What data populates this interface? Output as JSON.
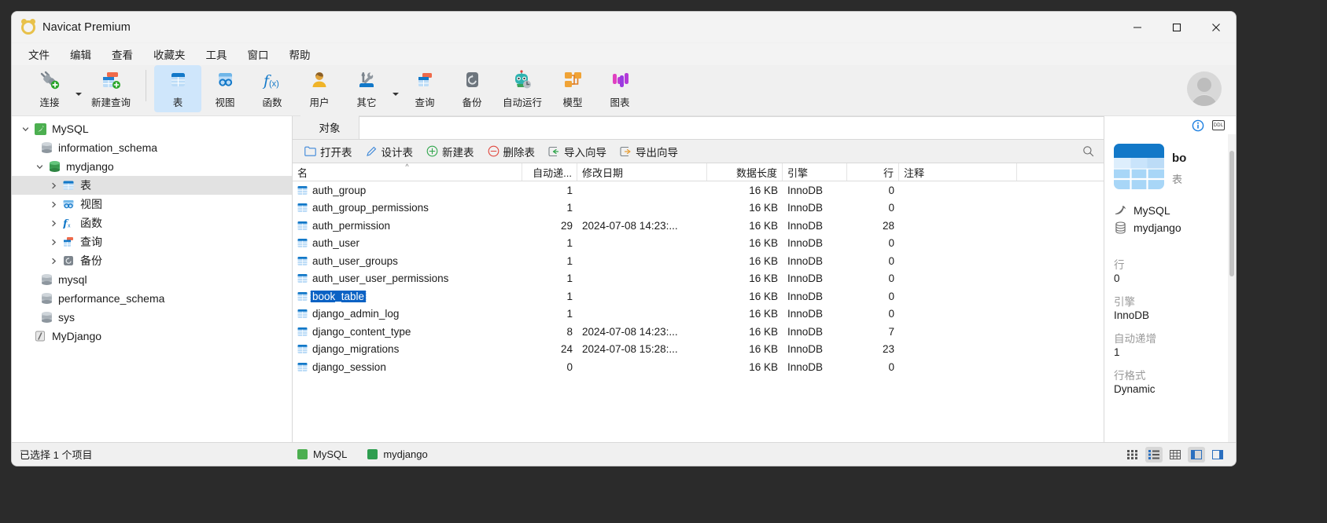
{
  "window": {
    "title": "Navicat Premium",
    "app_icon": "navicat-logo-icon",
    "minimize": "minimize-icon",
    "maximize": "maximize-icon",
    "close": "close-icon"
  },
  "menubar": {
    "items": [
      {
        "label": "文件"
      },
      {
        "label": "编辑"
      },
      {
        "label": "查看"
      },
      {
        "label": "收藏夹"
      },
      {
        "label": "工具"
      },
      {
        "label": "窗口"
      },
      {
        "label": "帮助"
      }
    ]
  },
  "toolbar": {
    "items": [
      {
        "label": "连接",
        "icon": "connection-icon",
        "caret": true,
        "active": false
      },
      {
        "label": "新建查询",
        "icon": "new-query-icon",
        "caret": false,
        "active": false
      },
      {
        "label": "表",
        "icon": "table-icon",
        "caret": false,
        "active": true
      },
      {
        "label": "视图",
        "icon": "view-icon",
        "caret": false,
        "active": false
      },
      {
        "label": "函数",
        "icon": "function-icon",
        "caret": false,
        "active": false
      },
      {
        "label": "用户",
        "icon": "user-icon",
        "caret": false,
        "active": false
      },
      {
        "label": "其它",
        "icon": "other-tools-icon",
        "caret": true,
        "active": false
      },
      {
        "label": "查询",
        "icon": "query-icon",
        "caret": false,
        "active": false
      },
      {
        "label": "备份",
        "icon": "backup-icon",
        "caret": false,
        "active": false
      },
      {
        "label": "自动运行",
        "icon": "automation-icon",
        "caret": false,
        "active": false
      },
      {
        "label": "模型",
        "icon": "model-icon",
        "caret": false,
        "active": false
      },
      {
        "label": "图表",
        "icon": "chart-icon",
        "caret": false,
        "active": false
      }
    ],
    "avatar": "user-avatar"
  },
  "sidebar": {
    "items": [
      {
        "label": "MySQL",
        "indent": 0,
        "twisty": "expanded",
        "icon": "mysql-connection-icon",
        "selected": false
      },
      {
        "label": "information_schema",
        "indent": 1,
        "twisty": "none",
        "icon": "database-icon",
        "selected": false
      },
      {
        "label": "mydjango",
        "indent": 1,
        "twisty": "expanded",
        "icon": "database-open-icon",
        "selected": false
      },
      {
        "label": "表",
        "indent": 2,
        "twisty": "collapsed",
        "icon": "tables-folder-icon",
        "selected": true
      },
      {
        "label": "视图",
        "indent": 2,
        "twisty": "collapsed",
        "icon": "views-folder-icon",
        "selected": false
      },
      {
        "label": "函数",
        "indent": 2,
        "twisty": "collapsed",
        "icon": "functions-folder-icon",
        "selected": false
      },
      {
        "label": "查询",
        "indent": 2,
        "twisty": "collapsed",
        "icon": "queries-folder-icon",
        "selected": false
      },
      {
        "label": "备份",
        "indent": 2,
        "twisty": "collapsed",
        "icon": "backups-folder-icon",
        "selected": false
      },
      {
        "label": "mysql",
        "indent": 1,
        "twisty": "none",
        "icon": "database-icon",
        "selected": false
      },
      {
        "label": "performance_schema",
        "indent": 1,
        "twisty": "none",
        "icon": "database-icon",
        "selected": false
      },
      {
        "label": "sys",
        "indent": 1,
        "twisty": "none",
        "icon": "database-icon",
        "selected": false
      },
      {
        "label": "MyDjango",
        "indent": 0,
        "twisty": "none",
        "icon": "model-file-icon",
        "selected": false
      }
    ]
  },
  "tabs": {
    "items": [
      {
        "label": "对象",
        "active": true
      }
    ]
  },
  "objectbar": {
    "buttons": [
      {
        "label": "打开表",
        "icon": "open-table-icon"
      },
      {
        "label": "设计表",
        "icon": "design-table-icon"
      },
      {
        "label": "新建表",
        "icon": "new-table-icon"
      },
      {
        "label": "删除表",
        "icon": "delete-table-icon"
      },
      {
        "label": "导入向导",
        "icon": "import-wizard-icon"
      },
      {
        "label": "导出向导",
        "icon": "export-wizard-icon"
      }
    ],
    "search_icon": "search-icon"
  },
  "grid": {
    "columns": [
      {
        "key": "name",
        "label": "名",
        "align": "left",
        "sorted": true
      },
      {
        "key": "autoinc",
        "label": "自动递...",
        "align": "right",
        "sorted": false
      },
      {
        "key": "modified",
        "label": "修改日期",
        "align": "left",
        "sorted": false
      },
      {
        "key": "length",
        "label": "数据长度",
        "align": "right",
        "sorted": false
      },
      {
        "key": "engine",
        "label": "引擎",
        "align": "left",
        "sorted": false
      },
      {
        "key": "rows",
        "label": "行",
        "align": "right",
        "sorted": false
      },
      {
        "key": "comment",
        "label": "注释",
        "align": "left",
        "sorted": false
      }
    ],
    "rows": [
      {
        "name": "auth_group",
        "autoinc": "1",
        "modified": "",
        "length": "16 KB",
        "engine": "InnoDB",
        "rows": "0",
        "comment": "",
        "selected": false
      },
      {
        "name": "auth_group_permissions",
        "autoinc": "1",
        "modified": "",
        "length": "16 KB",
        "engine": "InnoDB",
        "rows": "0",
        "comment": "",
        "selected": false
      },
      {
        "name": "auth_permission",
        "autoinc": "29",
        "modified": "2024-07-08 14:23:...",
        "length": "16 KB",
        "engine": "InnoDB",
        "rows": "28",
        "comment": "",
        "selected": false
      },
      {
        "name": "auth_user",
        "autoinc": "1",
        "modified": "",
        "length": "16 KB",
        "engine": "InnoDB",
        "rows": "0",
        "comment": "",
        "selected": false
      },
      {
        "name": "auth_user_groups",
        "autoinc": "1",
        "modified": "",
        "length": "16 KB",
        "engine": "InnoDB",
        "rows": "0",
        "comment": "",
        "selected": false
      },
      {
        "name": "auth_user_user_permissions",
        "autoinc": "1",
        "modified": "",
        "length": "16 KB",
        "engine": "InnoDB",
        "rows": "0",
        "comment": "",
        "selected": false
      },
      {
        "name": "book_table",
        "autoinc": "1",
        "modified": "",
        "length": "16 KB",
        "engine": "InnoDB",
        "rows": "0",
        "comment": "",
        "selected": true
      },
      {
        "name": "django_admin_log",
        "autoinc": "1",
        "modified": "",
        "length": "16 KB",
        "engine": "InnoDB",
        "rows": "0",
        "comment": "",
        "selected": false
      },
      {
        "name": "django_content_type",
        "autoinc": "8",
        "modified": "2024-07-08 14:23:...",
        "length": "16 KB",
        "engine": "InnoDB",
        "rows": "7",
        "comment": "",
        "selected": false
      },
      {
        "name": "django_migrations",
        "autoinc": "24",
        "modified": "2024-07-08 15:28:...",
        "length": "16 KB",
        "engine": "InnoDB",
        "rows": "23",
        "comment": "",
        "selected": false
      },
      {
        "name": "django_session",
        "autoinc": "0",
        "modified": "",
        "length": "16 KB",
        "engine": "InnoDB",
        "rows": "0",
        "comment": "",
        "selected": false
      }
    ]
  },
  "info_panel": {
    "info_icon": "info-icon",
    "ddl_icon": "ddl-icon",
    "object_icon": "table-large-icon",
    "object_name": "bo",
    "object_kind": "表",
    "connection_icon": "mysql-dolphin-icon",
    "connection": "MySQL",
    "database_icon": "database-icon",
    "database": "mydjango",
    "properties": [
      {
        "label": "行",
        "value": "0"
      },
      {
        "label": "引擎",
        "value": "InnoDB"
      },
      {
        "label": "自动递增",
        "value": "1"
      },
      {
        "label": "行格式",
        "value": "Dynamic"
      }
    ]
  },
  "statusbar": {
    "selection": "已选择 1 个项目",
    "connections": [
      {
        "label": "MySQL",
        "color": "#4caf50",
        "icon": "mysql-connection-icon"
      },
      {
        "label": "mydjango",
        "color": "#2e9e4f",
        "icon": "database-green-icon"
      }
    ],
    "view_buttons": [
      {
        "icon": "detail-grid-view-icon",
        "active": false
      },
      {
        "icon": "list-view-icon",
        "active": true
      },
      {
        "icon": "grid-view-icon",
        "active": false
      },
      {
        "icon": "left-pane-toggle-icon",
        "active": true
      },
      {
        "icon": "right-pane-toggle-icon",
        "active": false
      }
    ]
  }
}
